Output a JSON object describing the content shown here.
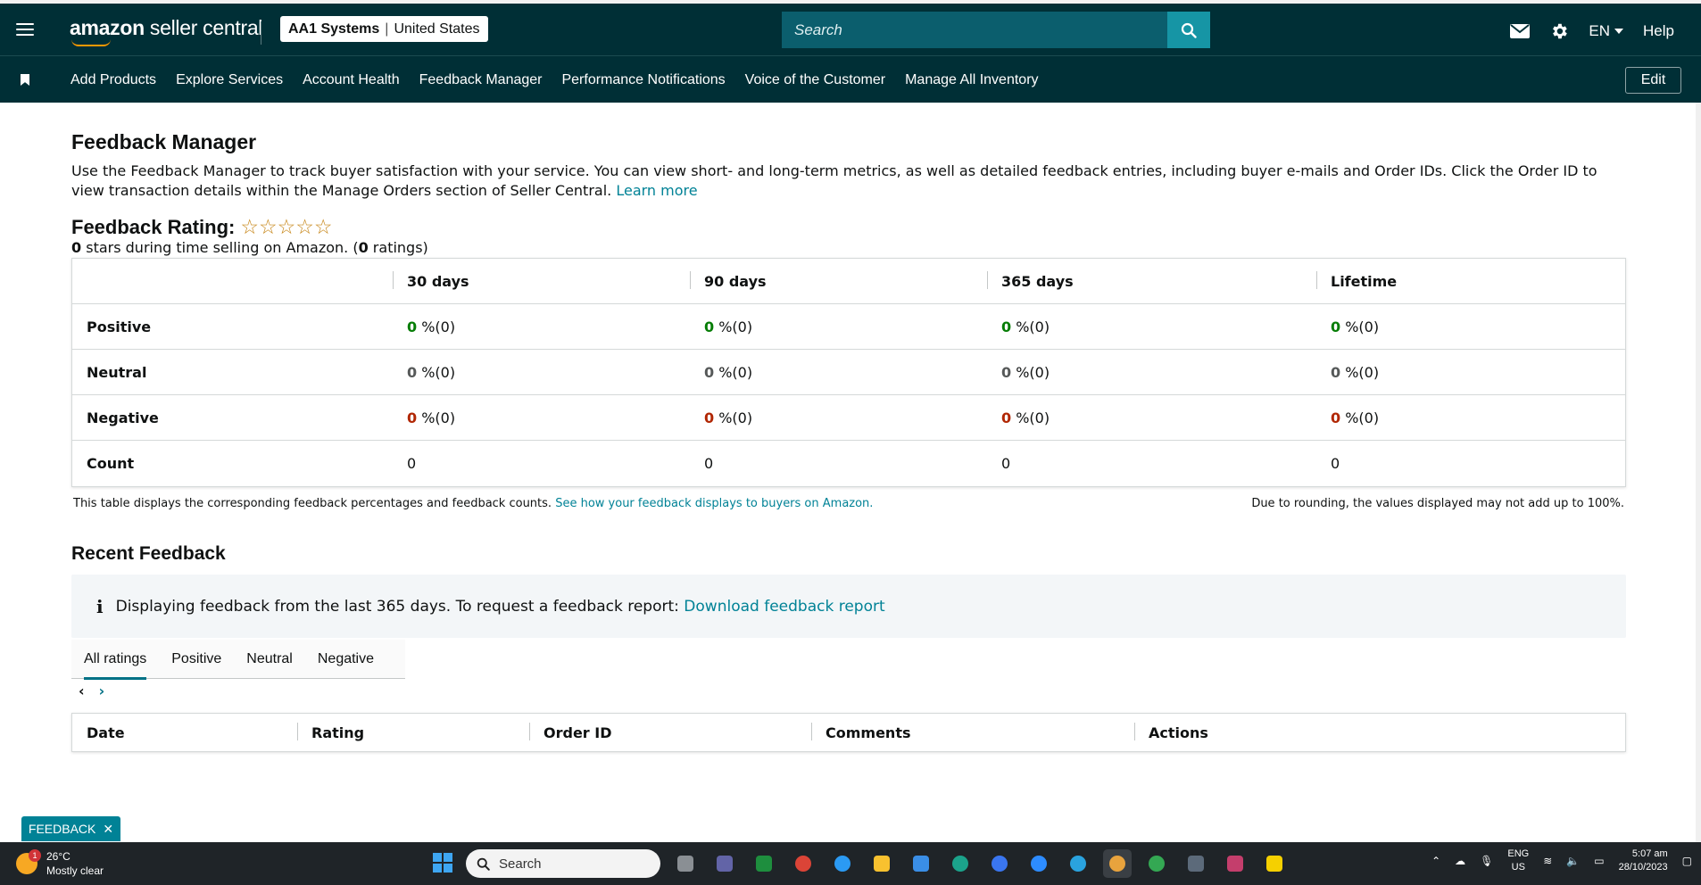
{
  "header": {
    "logo_bold": "amazon",
    "logo_rest": " seller central",
    "account_name": "AA1 Systems",
    "account_sep": "|",
    "account_region": "United States",
    "search_placeholder": "Search",
    "lang": "EN",
    "help": "Help"
  },
  "nav": {
    "items": [
      "Add Products",
      "Explore Services",
      "Account Health",
      "Feedback Manager",
      "Performance Notifications",
      "Voice of the Customer",
      "Manage All Inventory"
    ],
    "edit": "Edit"
  },
  "page": {
    "title": "Feedback Manager",
    "description": "Use the Feedback Manager to track buyer satisfaction with your service. You can view short- and long-term metrics, as well as detailed feedback entries, including buyer e-mails and Order IDs. Click the Order ID to view transaction details within the Manage Orders section of Seller Central.",
    "learn_more": "Learn more",
    "rating_title": "Feedback Rating:",
    "stars": "☆☆☆☆☆",
    "rating_stars_value": "0",
    "rating_mid": " stars during time selling on Amazon. (",
    "rating_count": "0",
    "rating_end": " ratings)"
  },
  "feedback_table": {
    "headers": [
      "",
      "30 days",
      "90 days",
      "365 days",
      "Lifetime"
    ],
    "rows": [
      {
        "label": "Positive",
        "kind": "pos",
        "values": [
          "0",
          "0",
          "0",
          "0"
        ],
        "suffix": " %(0)"
      },
      {
        "label": "Neutral",
        "kind": "neu",
        "values": [
          "0",
          "0",
          "0",
          "0"
        ],
        "suffix": " %(0)"
      },
      {
        "label": "Negative",
        "kind": "neg",
        "values": [
          "0",
          "0",
          "0",
          "0"
        ],
        "suffix": " %(0)"
      },
      {
        "label": "Count",
        "kind": "plain",
        "values": [
          "0",
          "0",
          "0",
          "0"
        ],
        "suffix": ""
      }
    ],
    "note": "This table displays the corresponding feedback percentages and feedback counts.",
    "note_link": "See how your feedback displays to buyers on Amazon.",
    "note_right": "Due to rounding, the values displayed may not add up to 100%."
  },
  "recent": {
    "title": "Recent Feedback",
    "info_text": "Displaying feedback from the last 365 days. To request a feedback report:",
    "info_link": "Download feedback report",
    "tabs": [
      "All ratings",
      "Positive",
      "Neutral",
      "Negative"
    ],
    "active_tab": 0,
    "columns": [
      "Date",
      "Rating",
      "Order ID",
      "Comments",
      "Actions"
    ]
  },
  "feedback_button": "FEEDBACK",
  "taskbar": {
    "temp": "26°C",
    "weather": "Mostly clear",
    "weather_badge": "1",
    "search": "Search",
    "lang_top": "ENG",
    "lang_bottom": "US",
    "time": "5:07 am",
    "date": "28/10/2023"
  },
  "colors": {
    "header_bg": "#002f36",
    "accent": "#008296",
    "positive": "#067d06",
    "negative": "#b12704",
    "star": "#c7871a"
  }
}
